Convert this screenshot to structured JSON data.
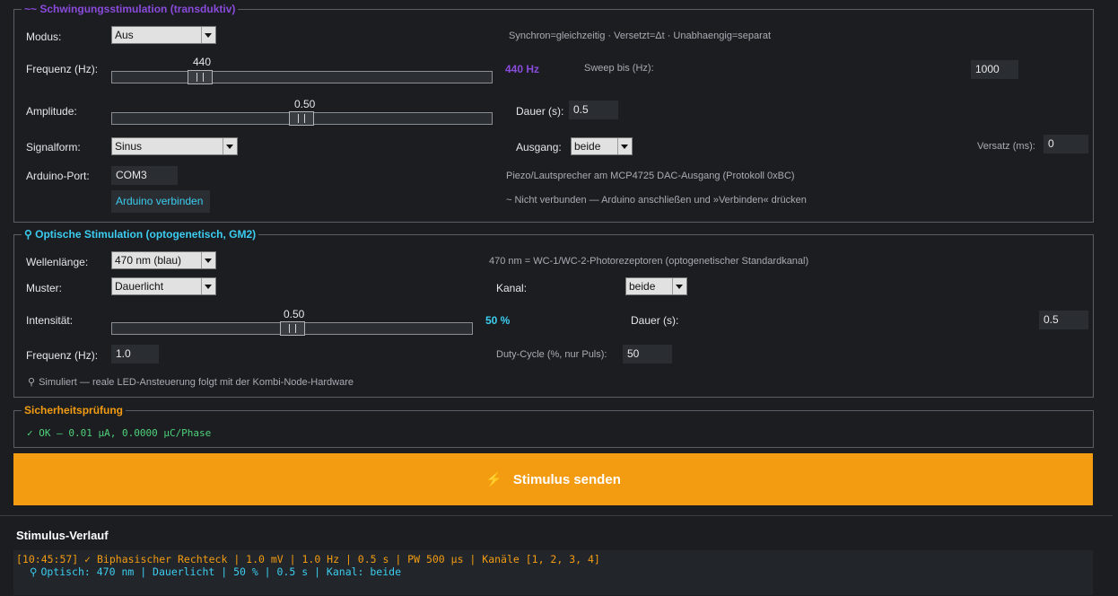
{
  "colors": {
    "accent_purple": "#8a4bdb",
    "accent_cyan": "#3ccdf0",
    "accent_orange": "#f39c12",
    "ok_green": "#4fd17a"
  },
  "vib": {
    "title": "Schwingungsstimulation (transduktiv)",
    "title_icon": "wave-icon",
    "modus_label": "Modus:",
    "modus_value": "Aus",
    "modus_hint": "Synchron=gleichzeitig  ·  Versetzt=Δt  ·  Unabhaengig=separat",
    "freq_label": "Frequenz (Hz):",
    "freq_slider_value": "440",
    "freq_slider_fraction": 0.18,
    "freq_display": "440 Hz",
    "sweep_label": "Sweep bis (Hz):",
    "sweep_value": "1000",
    "amp_label": "Amplitude:",
    "amp_slider_value": "0.50",
    "amp_slider_fraction": 0.5,
    "dauer_label": "Dauer (s):",
    "dauer_value": "0.5",
    "signal_label": "Signalform:",
    "signal_value": "Sinus",
    "ausgang_label": "Ausgang:",
    "ausgang_value": "beide",
    "versatz_label": "Versatz (ms):",
    "versatz_value": "0",
    "port_label": "Arduino-Port:",
    "port_value": "COM3",
    "port_hint": "Piezo/Lautsprecher am MCP4725 DAC-Ausgang (Protokoll 0xBC)",
    "connect_label": "Arduino verbinden",
    "status": "~ Nicht verbunden — Arduino anschließen und »Verbinden« drücken"
  },
  "opt": {
    "title": "Optische Stimulation (optogenetisch, GM2)",
    "title_icon": "lightbulb-icon",
    "wl_label": "Wellenlänge:",
    "wl_value": "470 nm (blau)",
    "wl_hint": "470 nm = WC-1/WC-2-Photorezeptoren (optogenetischer Standardkanal)",
    "muster_label": "Muster:",
    "muster_value": "Dauerlicht",
    "kanal_label": "Kanal:",
    "kanal_value": "beide",
    "int_label": "Intensität:",
    "int_slider_value": "0.50",
    "int_slider_fraction": 0.5,
    "int_display": "50 %",
    "dauer_label": "Dauer (s):",
    "dauer_value": "0.5",
    "freq_label": "Frequenz (Hz):",
    "freq_value": "1.0",
    "duty_label": "Duty-Cycle (%, nur Puls):",
    "duty_value": "50",
    "sim_note": "Simuliert — reale LED-Ansteuerung folgt mit der Kombi-Node-Hardware"
  },
  "safety": {
    "title": "Sicherheitsprüfung",
    "status": "✓  OK — 0.01 µA, 0.0000 µC/Phase"
  },
  "send_label": "Stimulus senden",
  "history": {
    "title": "Stimulus-Verlauf",
    "entry1": "[10:45:57] ✓ Biphasischer Rechteck | 1.0 mV | 1.0 Hz | 0.5 s | PW 500 µs | Kanäle [1, 2, 3, 4]",
    "entry2": "Optisch: 470 nm | Dauerlicht | 50 % | 0.5 s | Kanal: beide"
  }
}
